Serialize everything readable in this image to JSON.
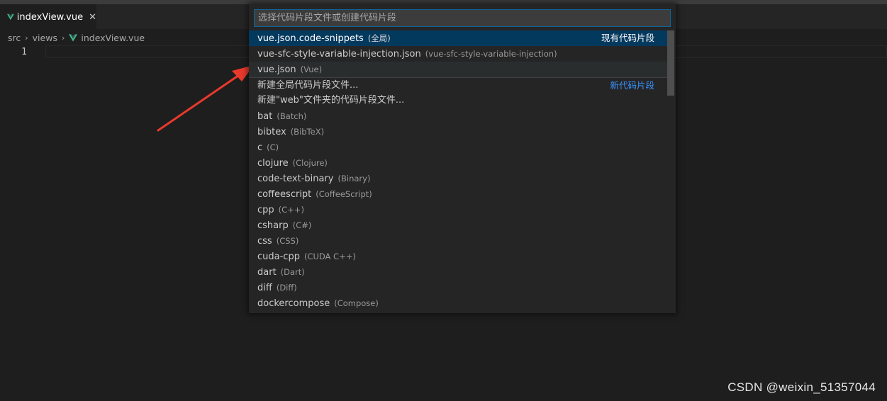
{
  "tab": {
    "label": "indexView.vue",
    "close": "✕",
    "icon": "vue-icon"
  },
  "breadcrumb": {
    "items": [
      "src",
      "views",
      "indexView.vue"
    ],
    "separator": "›"
  },
  "editor": {
    "line": "1"
  },
  "quick_pick": {
    "placeholder": "选择代码片段文件或创建代码片段",
    "items": [
      {
        "label": "vue.json.code-snippets",
        "desc": "(全局)",
        "badge": "现有代码片段"
      },
      {
        "label": "vue-sfc-style-variable-injection.json",
        "desc": "(vue-sfc-style-variable-injection)"
      },
      {
        "label": "vue.json",
        "desc": "(Vue)"
      },
      {
        "label": "新建全局代码片段文件...",
        "badge": "新代码片段"
      },
      {
        "label": "新建\"web\"文件夹的代码片段文件..."
      },
      {
        "label": "bat",
        "desc": "(Batch)"
      },
      {
        "label": "bibtex",
        "desc": "(BibTeX)"
      },
      {
        "label": "c",
        "desc": "(C)"
      },
      {
        "label": "clojure",
        "desc": "(Clojure)"
      },
      {
        "label": "code-text-binary",
        "desc": "(Binary)"
      },
      {
        "label": "coffeescript",
        "desc": "(CoffeeScript)"
      },
      {
        "label": "cpp",
        "desc": "(C++)"
      },
      {
        "label": "csharp",
        "desc": "(C#)"
      },
      {
        "label": "css",
        "desc": "(CSS)"
      },
      {
        "label": "cuda-cpp",
        "desc": "(CUDA C++)"
      },
      {
        "label": "dart",
        "desc": "(Dart)"
      },
      {
        "label": "diff",
        "desc": "(Diff)"
      },
      {
        "label": "dockercompose",
        "desc": "(Compose)"
      }
    ]
  },
  "watermark": "CSDN @weixin_51357044",
  "colors": {
    "accent": "#0e639c",
    "selected": "#04395e",
    "link": "#3794ff",
    "vue": "#41b883",
    "arrow": "#e8392c"
  }
}
